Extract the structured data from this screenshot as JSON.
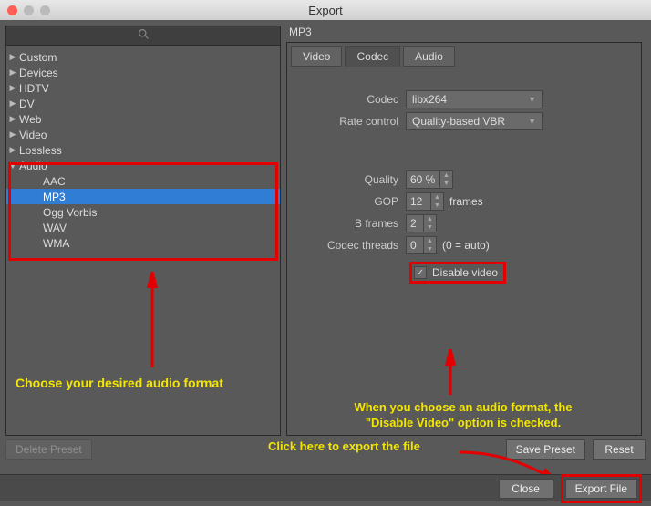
{
  "window": {
    "title": "Export"
  },
  "sidebar": {
    "items": [
      {
        "label": "Custom",
        "expanded": false
      },
      {
        "label": "Devices",
        "expanded": false
      },
      {
        "label": "HDTV",
        "expanded": false
      },
      {
        "label": "DV",
        "expanded": false
      },
      {
        "label": "Web",
        "expanded": false
      },
      {
        "label": "Video",
        "expanded": false
      },
      {
        "label": "Lossless",
        "expanded": false
      },
      {
        "label": "Audio",
        "expanded": true,
        "children": [
          {
            "label": "AAC",
            "selected": false
          },
          {
            "label": "MP3",
            "selected": true
          },
          {
            "label": "Ogg Vorbis",
            "selected": false
          },
          {
            "label": "WAV",
            "selected": false
          },
          {
            "label": "WMA",
            "selected": false
          }
        ]
      }
    ]
  },
  "format_label": "MP3",
  "tabs": [
    {
      "label": "Video",
      "active": false
    },
    {
      "label": "Codec",
      "active": true
    },
    {
      "label": "Audio",
      "active": false
    }
  ],
  "form": {
    "codec": {
      "label": "Codec",
      "value": "libx264"
    },
    "rate_control": {
      "label": "Rate control",
      "value": "Quality-based VBR"
    },
    "quality": {
      "label": "Quality",
      "value": "60 %"
    },
    "gop": {
      "label": "GOP",
      "value": "12",
      "suffix": "frames"
    },
    "bframes": {
      "label": "B frames",
      "value": "2"
    },
    "threads": {
      "label": "Codec threads",
      "value": "0",
      "suffix": "(0 = auto)"
    },
    "disable_video": {
      "label": "Disable video",
      "checked": true
    }
  },
  "buttons": {
    "delete_preset": "Delete Preset",
    "save_preset": "Save Preset",
    "reset": "Reset",
    "close": "Close",
    "export_file": "Export File"
  },
  "annotations": {
    "choose_format": "Choose your desired audio format",
    "disable_note_l1": "When you choose an audio format, the",
    "disable_note_l2": "\"Disable Video\" option is checked.",
    "export_note": "Click here to export the file"
  },
  "colors": {
    "highlight": "#e30000",
    "annotation": "#f3e600",
    "selection": "#2f7dd5"
  }
}
